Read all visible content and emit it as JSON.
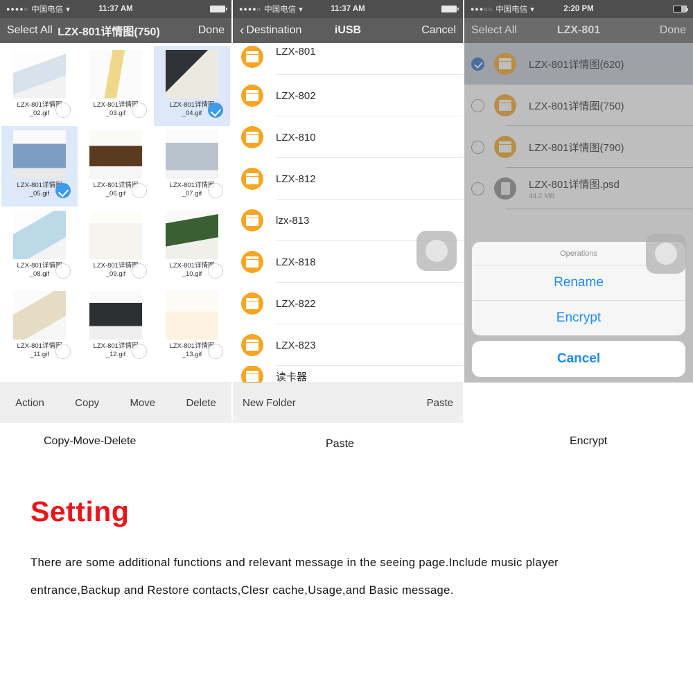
{
  "panel1": {
    "status": {
      "dots": "●●●●○",
      "carrier": "中国电信",
      "wifi": "▾",
      "time": "11:37 AM"
    },
    "nav": {
      "left": "Select All",
      "title": "LZX-801详情图(750)",
      "right": "Done"
    },
    "grid": [
      {
        "name1": "LZX-801详情图",
        "name2": "_02.gif",
        "selected": false
      },
      {
        "name1": "LZX-801详情图",
        "name2": "_03.gif",
        "selected": false
      },
      {
        "name1": "LZX-801详情图",
        "name2": "_04.gif",
        "selected": true
      },
      {
        "name1": "LZX-801详情图",
        "name2": "_05.gif",
        "selected": true
      },
      {
        "name1": "LZX-801详情图",
        "name2": "_06.gif",
        "selected": false
      },
      {
        "name1": "LZX-801详情图",
        "name2": "_07.gif",
        "selected": false
      },
      {
        "name1": "LZX-801详情图",
        "name2": "_08.gif",
        "selected": false
      },
      {
        "name1": "LZX-801详情图",
        "name2": "_09.gif",
        "selected": false
      },
      {
        "name1": "LZX-801详情图",
        "name2": "_10.gif",
        "selected": false
      },
      {
        "name1": "LZX-801详情图",
        "name2": "_11.gif",
        "selected": false
      },
      {
        "name1": "LZX-801详情图",
        "name2": "_12.gif",
        "selected": false
      },
      {
        "name1": "LZX-801详情图",
        "name2": "_13.gif",
        "selected": false
      }
    ],
    "toolbar": {
      "action": "Action",
      "copy": "Copy",
      "move": "Move",
      "delete": "Delete"
    }
  },
  "panel2": {
    "status": {
      "dots": "●●●●○",
      "carrier": "中国电信",
      "wifi": "▾",
      "time": "11:37 AM"
    },
    "nav": {
      "back": "Destination",
      "title": "iUSB",
      "right": "Cancel"
    },
    "rows": [
      {
        "label": "LZX-801",
        "icon": "folder-icon"
      },
      {
        "label": "LZX-802",
        "icon": "folder-icon"
      },
      {
        "label": "LZX-810",
        "icon": "folder-icon"
      },
      {
        "label": "LZX-812",
        "icon": "folder-icon"
      },
      {
        "label": "lzx-813",
        "icon": "folder-icon"
      },
      {
        "label": "LZX-818",
        "icon": "folder-icon"
      },
      {
        "label": "LZX-822",
        "icon": "folder-icon"
      },
      {
        "label": "LZX-823",
        "icon": "folder-icon"
      },
      {
        "label": "读卡器",
        "icon": "folder-icon"
      }
    ],
    "toolbar": {
      "new_folder": "New Folder",
      "paste": "Paste"
    }
  },
  "panel3": {
    "status": {
      "dots": "●●●○○",
      "carrier": "中国电信",
      "wifi": "▾",
      "time": "2:20 PM"
    },
    "nav": {
      "left": "Select All",
      "title": "LZX-801",
      "right": "Done"
    },
    "rows": [
      {
        "label": "LZX-801详情图(620)",
        "sub": "",
        "icon": "folder-icon",
        "checked": true
      },
      {
        "label": "LZX-801详情图(750)",
        "sub": "",
        "icon": "folder-icon",
        "checked": false
      },
      {
        "label": "LZX-801详情图(790)",
        "sub": "",
        "icon": "folder-icon",
        "checked": false
      },
      {
        "label": "LZX-801详情图.psd",
        "sub": "44.2 MB",
        "icon": "document-icon",
        "checked": false
      }
    ],
    "sheet": {
      "title": "Operations",
      "rename": "Rename",
      "encrypt": "Encrypt",
      "cancel": "Cancel"
    }
  },
  "captions": {
    "one": "Copy-Move-Delete",
    "two": "Paste",
    "three": "Encrypt"
  },
  "setting": {
    "heading": "Setting",
    "body": "There are some additional functions and relevant message in the seeing page.Include music player entrance,Backup and Restore contacts,Clesr cache,Usage,and Basic message."
  },
  "colors": {
    "accent_red": "#e8161a",
    "folder_orange": "#f5a623",
    "ios_blue": "#1f8bf5",
    "statusbar": "#4e4e4e"
  }
}
